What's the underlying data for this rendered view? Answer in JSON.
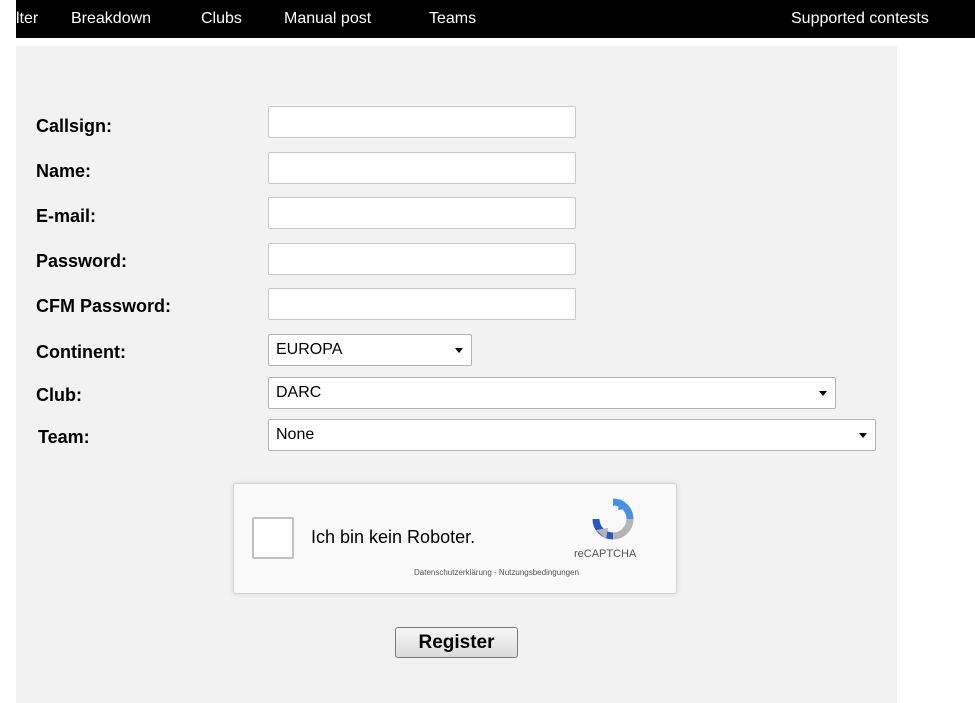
{
  "nav": {
    "items": [
      "lter",
      "Breakdown",
      "Clubs",
      "Manual post",
      "Teams"
    ],
    "right_item": "Supported contests"
  },
  "form": {
    "callsign_label": "Callsign:",
    "callsign_value": "",
    "name_label": "Name:",
    "name_value": "",
    "email_label": "E-mail:",
    "email_value": "",
    "password_label": "Password:",
    "password_value": "",
    "cfm_password_label": "CFM Password:",
    "cfm_password_value": "",
    "continent_label": "Continent:",
    "continent_value": "EUROPA",
    "club_label": "Club:",
    "club_value": "DARC",
    "team_label": "Team:",
    "team_value": "None",
    "register_label": "Register"
  },
  "captcha": {
    "label": "Ich bin kein Roboter.",
    "brand": "reCAPTCHA",
    "legal": "Datenschutzerklärung - Nutzungsbedingungen",
    "icon": "recaptcha-logo-icon"
  },
  "colors": {
    "navbar_bg": "#000000",
    "panel_bg": "#f2f2f2",
    "recaptcha_blue": "#4a90e2",
    "recaptcha_grey": "#b4b4b4"
  }
}
